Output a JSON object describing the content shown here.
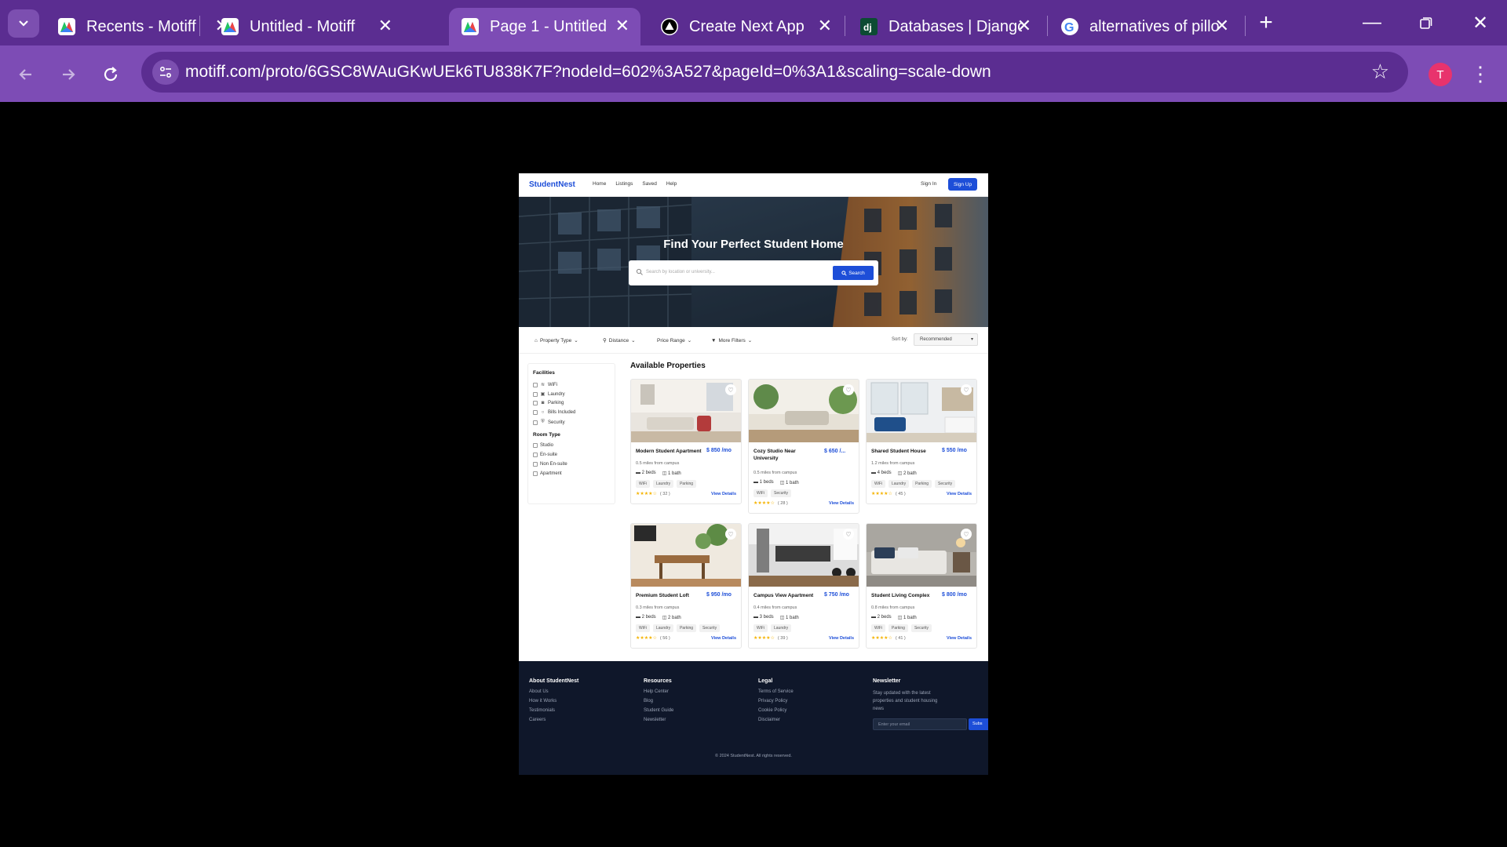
{
  "browser": {
    "tabs": [
      {
        "title": "Recents - Motiff",
        "icon": "motiff-icon"
      },
      {
        "title": "Untitled - Motiff",
        "icon": "motiff-icon"
      },
      {
        "title": "Page 1 - Untitled",
        "icon": "motiff-icon",
        "active": true
      },
      {
        "title": "Create Next App",
        "icon": "vercel-icon"
      },
      {
        "title": "Databases | Django",
        "icon": "django-icon"
      },
      {
        "title": "alternatives of pillo",
        "icon": "google-icon"
      }
    ],
    "url": "motiff.com/proto/6GSC8WAuGKwUEk6TU838K7F?nodeId=602%3A527&pageId=0%3A1&scaling=scale-down",
    "profile_initial": "T",
    "colors": {
      "tabbar": "#5b2d91",
      "toolbar": "#7d4cb5",
      "avatar": "#e8336d"
    }
  },
  "site": {
    "brand": "StudentNest",
    "nav": [
      "Home",
      "Listings",
      "Saved",
      "Help"
    ],
    "sign_in": "Sign In",
    "sign_up": "Sign Up",
    "hero_title": "Find Your Perfect Student Home",
    "search_placeholder": "Search by location or university...",
    "search_button": "Search",
    "filters": [
      "Property Type",
      "Distance",
      "Price Range",
      "More Filters"
    ],
    "sort_label": "Sort by:",
    "sort_value": "Recommended",
    "sidebar": {
      "facilities_title": "Facilities",
      "facilities": [
        "WiFi",
        "Laundry",
        "Parking",
        "Bills Included",
        "Security"
      ],
      "room_type_title": "Room Type",
      "room_types": [
        "Studio",
        "En-suite",
        "Non En-suite",
        "Apartment"
      ]
    },
    "listing_title": "Available Properties",
    "properties": [
      {
        "title": "Modern Student Apartment",
        "price": "$ 850 /mo",
        "distance": "0.5 miles from campus",
        "beds": "2 beds",
        "baths": "1 bath",
        "tags": [
          "WiFi",
          "Laundry",
          "Parking"
        ],
        "rating": 4,
        "reviews": "( 32 )",
        "link": "View Details"
      },
      {
        "title": "Cozy Studio Near University",
        "price": "$ 650 /...",
        "distance": "0.5 miles from campus",
        "beds": "1 beds",
        "baths": "1 bath",
        "tags": [
          "WiFi",
          "Security"
        ],
        "rating": 4,
        "reviews": "( 28 )",
        "link": "View Details"
      },
      {
        "title": "Shared Student House",
        "price": "$ 550 /mo",
        "distance": "1.2 miles from campus",
        "beds": "4 beds",
        "baths": "2 bath",
        "tags": [
          "WiFi",
          "Laundry",
          "Parking",
          "Security"
        ],
        "rating": 4,
        "reviews": "( 45 )",
        "link": "View Details"
      },
      {
        "title": "Premium Student Loft",
        "price": "$ 950 /mo",
        "distance": "0.3 miles from campus",
        "beds": "2 beds",
        "baths": "2 bath",
        "tags": [
          "WiFi",
          "Laundry",
          "Parking",
          "Security"
        ],
        "rating": 4,
        "reviews": "( 56 )",
        "link": "View Details"
      },
      {
        "title": "Campus View Apartment",
        "price": "$ 750 /mo",
        "distance": "0.4 miles from campus",
        "beds": "3 beds",
        "baths": "1 bath",
        "tags": [
          "WiFi",
          "Laundry"
        ],
        "rating": 4,
        "reviews": "( 39 )",
        "link": "View Details"
      },
      {
        "title": "Student Living Complex",
        "price": "$ 800 /mo",
        "distance": "0.8 miles from campus",
        "beds": "2 beds",
        "baths": "1 bath",
        "tags": [
          "WiFi",
          "Parking",
          "Security"
        ],
        "rating": 4,
        "reviews": "( 41 )",
        "link": "View Details"
      }
    ],
    "footer": {
      "about_title": "About StudentNest",
      "about_links": [
        "About Us",
        "How it Works",
        "Testimonials",
        "Careers"
      ],
      "resources_title": "Resources",
      "resources_links": [
        "Help Center",
        "Blog",
        "Student Guide",
        "Newsletter"
      ],
      "legal_title": "Legal",
      "legal_links": [
        "Terms of Service",
        "Privacy Policy",
        "Cookie Policy",
        "Disclaimer"
      ],
      "newsletter_title": "Newsletter",
      "newsletter_text": "Stay updated with the latest properties and student housing news",
      "email_placeholder": "Enter your email",
      "subscribe": "Subs",
      "copyright": "© 2024 StudentNest. All rights reserved."
    },
    "colors": {
      "primary": "#1d4ed8",
      "footer": "#0f172a",
      "star": "#f5b301"
    }
  }
}
